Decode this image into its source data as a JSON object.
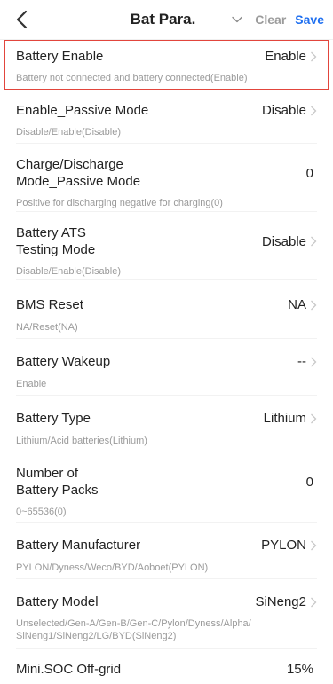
{
  "header": {
    "title": "Bat Para.",
    "clear_label": "Clear",
    "save_label": "Save"
  },
  "colors": {
    "accent": "#1e6ff0",
    "highlight_border": "#e2453c",
    "hint": "#9a9a9a"
  },
  "rows": [
    {
      "label": "Battery Enable",
      "value": "Enable",
      "hint": "Battery not connected and battery connected(Enable)"
    },
    {
      "label": "Enable_Passive Mode",
      "value": "Disable",
      "hint": "Disable/Enable(Disable)"
    },
    {
      "label_line1": "Charge/Discharge",
      "label_line2": "Mode_Passive Mode",
      "value": "0",
      "hint": "Positive for discharging  negative for charging(0)"
    },
    {
      "label_line1": "Battery ATS",
      "label_line2": "Testing Mode",
      "value": "Disable",
      "hint": "Disable/Enable(Disable)"
    },
    {
      "label": "BMS Reset",
      "value": "NA",
      "hint": "NA/Reset(NA)"
    },
    {
      "label": "Battery Wakeup",
      "value": "--",
      "hint": "Enable"
    },
    {
      "label": "Battery Type",
      "value": "Lithium",
      "hint": "Lithium/Acid batteries(Lithium)"
    },
    {
      "label_line1": "Number of",
      "label_line2": "Battery Packs",
      "value": "0",
      "hint": "0~65536(0)"
    },
    {
      "label": "Battery Manufacturer",
      "value": "PYLON",
      "hint": "PYLON/Dyness/Weco/BYD/Aoboet(PYLON)"
    },
    {
      "label": "Battery Model",
      "value": "SiNeng2",
      "hint_line1": "Unselected/Gen-A/Gen-B/Gen-C/Pylon/Dyness/Alpha/",
      "hint_line2": "SiNeng1/SiNeng2/LG/BYD(SiNeng2)"
    },
    {
      "label": "Mini.SOC Off-grid",
      "value": "15%"
    }
  ]
}
